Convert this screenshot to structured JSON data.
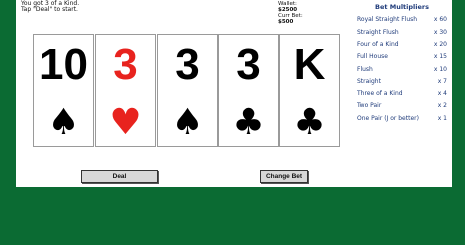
{
  "status": {
    "line1": "You got 3 of a Kind.",
    "line2": "Tap \"Deal\" to start."
  },
  "wallet": {
    "wallet_label": "Wallet:",
    "wallet_value": "$2500",
    "bet_label": "Curr Bet:",
    "bet_value": "$500"
  },
  "hand": [
    {
      "rank": "10",
      "suit": "♠",
      "suit_icon": "spade-icon",
      "color": "#000000"
    },
    {
      "rank": "3",
      "suit": "♥",
      "suit_icon": "heart-icon",
      "color": "#e8231e"
    },
    {
      "rank": "3",
      "suit": "♠",
      "suit_icon": "spade-icon",
      "color": "#000000"
    },
    {
      "rank": "3",
      "suit": "♣",
      "suit_icon": "club-icon",
      "color": "#000000"
    },
    {
      "rank": "K",
      "suit": "♣",
      "suit_icon": "club-icon",
      "color": "#000000"
    }
  ],
  "multipliers": {
    "title": "Bet Multipliers",
    "rows": [
      {
        "name": "Royal Straight Flush",
        "mult": "x 60"
      },
      {
        "name": "Straight Flush",
        "mult": "x 30"
      },
      {
        "name": "Four of a Kind",
        "mult": "x 20"
      },
      {
        "name": "Full House",
        "mult": "x 15"
      },
      {
        "name": "Flush",
        "mult": "x 10"
      },
      {
        "name": "Straight",
        "mult": "x 7"
      },
      {
        "name": "Three of a Kind",
        "mult": "x 4"
      },
      {
        "name": "Two Pair",
        "mult": "x 2"
      },
      {
        "name": "One Pair (J or better)",
        "mult": "x 1"
      }
    ]
  },
  "buttons": {
    "deal": "Deal",
    "change_bet": "Change Bet"
  },
  "colors": {
    "background": "#0b6b33",
    "panel": "#ffffff",
    "multiplier_text": "#1f3b7a",
    "red_suit": "#e8231e"
  }
}
